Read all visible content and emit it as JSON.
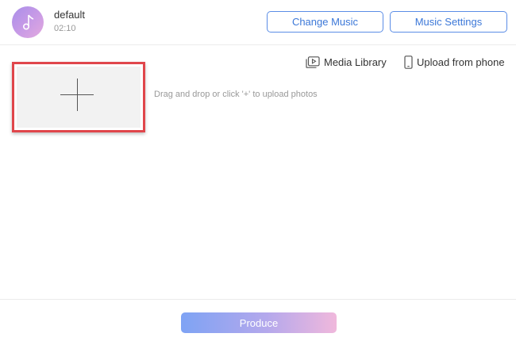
{
  "music": {
    "title": "default",
    "duration": "02:10",
    "icon": "music-note-icon",
    "avatar_gradient": [
      "#a98ee9",
      "#e3a9de"
    ]
  },
  "header": {
    "change_music_label": "Change Music",
    "music_settings_label": "Music Settings",
    "accent_color": "#3c78d8"
  },
  "upload_sources": {
    "media_library_label": "Media Library",
    "media_library_icon": "media-library-icon",
    "upload_phone_label": "Upload from phone",
    "upload_phone_icon": "phone-icon"
  },
  "upload_area": {
    "add_icon": "plus-icon",
    "hint": "Drag and drop or click '+' to upload photos",
    "highlight_color": "#e0464b"
  },
  "footer": {
    "produce_label": "Produce",
    "produce_gradient": [
      "#7ea3f4",
      "#f0b8dc"
    ]
  }
}
